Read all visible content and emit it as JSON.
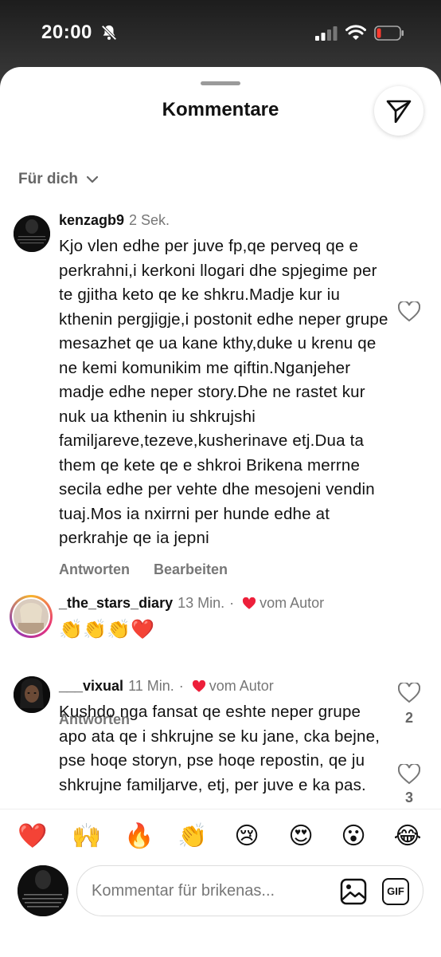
{
  "status": {
    "time": "20:00"
  },
  "sheet": {
    "title": "Kommentare"
  },
  "sort": {
    "label": "Für dich"
  },
  "comments": [
    {
      "user": "kenzagb9",
      "time": "2 Sek.",
      "text": "Kjo vlen edhe per juve fp,qe perveq qe e perkrahni,i kerkoni llogari dhe spjegime per te gjitha keto qe ke shkru.Madje kur iu kthenin pergjigje,i postonit edhe neper grupe mesazhet qe ua kane kthy,duke u krenu qe ne kemi komunikim me qiftin.Nganjeher madje edhe neper story.Dhe ne rastet kur nuk ua kthenin iu shkrujshi familjareve,tezeve,kusherinave etj.Dua ta them qe kete qe e shkroi Brikena merrne secila edhe per vehte dhe mesojeni vendin tuaj.Mos ia nxirrni per hunde edhe at perkrahje qe ia jepni",
      "reply": "Antworten",
      "edit": "Bearbeiten",
      "likes": ""
    },
    {
      "user": "_the_stars_diary",
      "time": "13 Min.",
      "author_badge": "vom Autor",
      "text": "👏👏👏❤️",
      "reply": "Antworten",
      "likes": "2"
    },
    {
      "user": "___vixual",
      "time": "11 Min.",
      "author_badge": "vom Autor",
      "text": "Kushdo nga fansat qe eshte neper grupe apo ata qe i shkrujne se ku jane, cka bejne, pse hoqe storyn, pse hoqe repostin, qe ju shkrujne familjarve, etj, per juve e ka pas.",
      "likes": "3"
    }
  ],
  "emojis": [
    "❤️",
    "🙌",
    "🔥",
    "👏",
    "😢",
    "😍",
    "😮",
    "😂"
  ],
  "composer": {
    "placeholder": "Kommentar für brikenas...",
    "gif_label": "GIF"
  },
  "colors": {
    "heart_red": "#ed1f3a",
    "text_muted": "#777777"
  }
}
